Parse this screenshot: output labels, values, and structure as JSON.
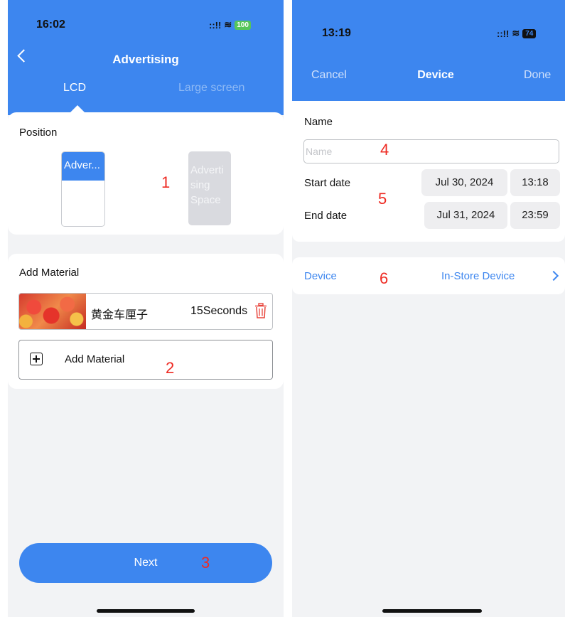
{
  "left_screen": {
    "status": {
      "time": "16:02",
      "signal": "::!!",
      "battery": "100"
    },
    "header": {
      "title": "Advertising"
    },
    "tabs": [
      {
        "label": "LCD",
        "active": true
      },
      {
        "label": "Large screen",
        "active": false
      }
    ],
    "position": {
      "label": "Position",
      "slots": [
        {
          "label": "Adver...",
          "selected": true
        },
        {
          "label": "Adverti sing Space",
          "selected": false
        }
      ]
    },
    "material": {
      "label": "Add Material",
      "items": [
        {
          "name": "黄金车厘子",
          "duration": "15Seconds"
        }
      ],
      "add_label": "Add Material"
    },
    "next_label": "Next"
  },
  "right_screen": {
    "status": {
      "time": "13:19",
      "signal": "::!!",
      "battery": "74"
    },
    "nav": {
      "cancel": "Cancel",
      "title": "Device",
      "done": "Done"
    },
    "form": {
      "name_label": "Name",
      "name_value": "",
      "name_placeholder": "Name",
      "start_label": "Start date",
      "start_date": "Jul 30, 2024",
      "start_time": "13:18",
      "end_label": "End date",
      "end_date": "Jul 31, 2024",
      "end_time": "23:59"
    },
    "device": {
      "label": "Device",
      "value": "In-Store Device"
    }
  },
  "annotations": [
    "1",
    "2",
    "3",
    "4",
    "5",
    "6"
  ],
  "colors": {
    "accent": "#3d86ef",
    "annotation": "#ee2a22",
    "background": "#f2f3f5",
    "delete": "#e8453c"
  }
}
